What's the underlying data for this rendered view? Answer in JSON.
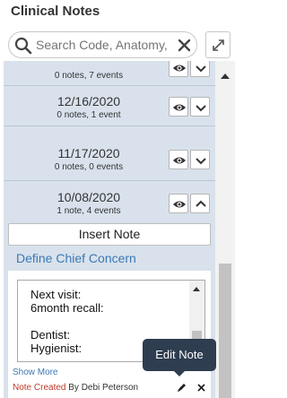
{
  "header": {
    "title": "Clinical Notes"
  },
  "search": {
    "placeholder": "Search Code, Anatomy,"
  },
  "notes": [
    {
      "date": "",
      "counts": "0 notes,  7 events",
      "expanded": false
    },
    {
      "date": "12/16/2020",
      "counts": "0 notes,  1 event",
      "expanded": false
    },
    {
      "date": "11/17/2020",
      "counts": "0 notes,  0 events",
      "expanded": false
    },
    {
      "date": "10/08/2020",
      "counts": "1 note,  4 events",
      "expanded": true
    }
  ],
  "insert_note_label": "Insert Note",
  "chief_concern_label": "Define Chief Concern",
  "note_body": "Next visit:\n6month recall:\n\nDentist:\nHygienist:",
  "show_more_label": "Show More",
  "created": {
    "status": "Note Created",
    "by": " By Debi Peterson"
  },
  "tooltip": "Edit Note",
  "colors": {
    "panel": "#d9e2ec",
    "link": "#3c78b4",
    "tooltip": "#2e3d4f",
    "status": "#c0392b"
  }
}
